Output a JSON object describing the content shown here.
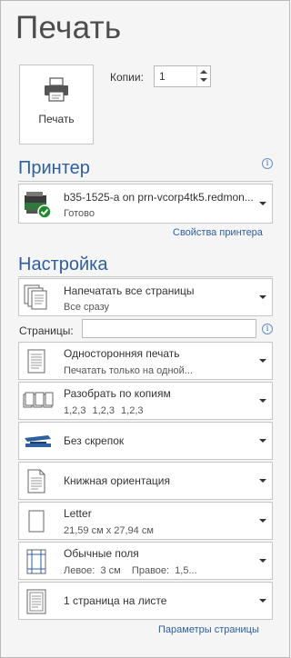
{
  "title": "Печать",
  "print_button": {
    "label": "Печать"
  },
  "copies": {
    "label": "Копии:",
    "value": "1"
  },
  "printer_section": {
    "title": "Принтер",
    "printer_name": "b35-1525-a on prn-vcorp4tk5.redmon...",
    "printer_status": "Готово",
    "properties_link": "Свойства принтера"
  },
  "settings_section": {
    "title": "Настройка",
    "pages_label": "Страницы:",
    "pages_value": "",
    "page_setup_link": "Параметры страницы",
    "items": [
      {
        "line1": "Напечатать все страницы",
        "line2": "Все сразу"
      },
      {
        "line1": "Односторонняя печать",
        "line2": "Печатать только на одной..."
      },
      {
        "line1": "Разобрать по копиям",
        "line2": "1,2,3    1,2,3    1,2,3"
      },
      {
        "line1": "Без скрепок",
        "line2": ""
      },
      {
        "line1": "Книжная ориентация",
        "line2": ""
      },
      {
        "line1": "Letter",
        "line2": "21,59 см x 27,94 см"
      },
      {
        "line1": "Обычные поля",
        "line2": "Левое:  3 см    Правое:  1,5..."
      },
      {
        "line1": "1 страница на листе",
        "line2": ""
      }
    ]
  },
  "colors": {
    "accent": "#2e5f9e",
    "background": "#f5f5f5",
    "border": "#c6c6c6"
  }
}
